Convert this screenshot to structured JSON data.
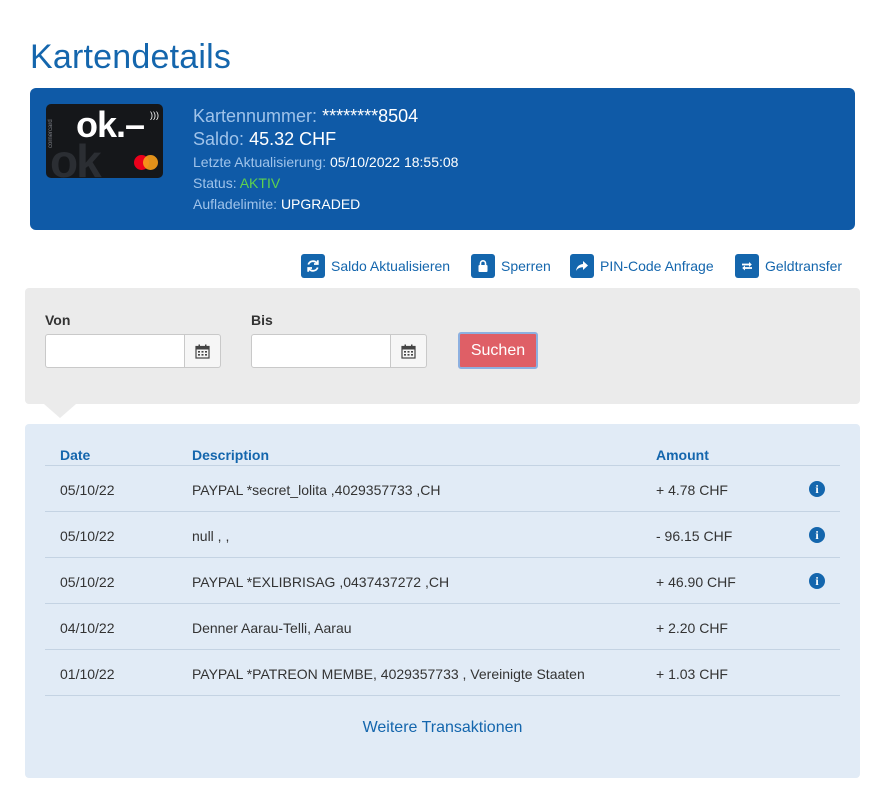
{
  "page": {
    "title": "Kartendetails"
  },
  "card": {
    "image": {
      "logo_text": "ok.–",
      "side_text": "cornercard",
      "brand": "mastercard-logo",
      "bg_color": "#15171a"
    },
    "number_label": "Kartennummer:",
    "number_value": "********8504",
    "balance_label": "Saldo:",
    "balance_value": "45.32 CHF",
    "updated_label": "Letzte Aktualisierung:",
    "updated_value": "05/10/2022 18:55:08",
    "status_label": "Status:",
    "status_value": "AKTIV",
    "limit_label": "Aufladelimite:",
    "limit_value": "UPGRADED",
    "panel_color": "#0f5aa7",
    "status_color": "#5ed24e"
  },
  "actions": [
    {
      "label": "Saldo Aktualisieren",
      "icon": "refresh-icon"
    },
    {
      "label": "Sperren",
      "icon": "lock-icon"
    },
    {
      "label": "PIN-Code Anfrage",
      "icon": "share-arrow-icon"
    },
    {
      "label": "Geldtransfer",
      "icon": "transfer-icon"
    }
  ],
  "filter": {
    "from_label": "Von",
    "from_value": "",
    "to_label": "Bis",
    "to_value": "",
    "search_label": "Suchen",
    "search_color": "#df5f66"
  },
  "transactions": {
    "columns": [
      "Date",
      "Description",
      "Amount"
    ],
    "rows": [
      {
        "date": "05/10/22",
        "description": "PAYPAL *secret_lolita ,4029357733 ,CH",
        "amount": "+ 4.78 CHF",
        "has_info": true
      },
      {
        "date": "05/10/22",
        "description": "null , ,",
        "amount": "- 96.15 CHF",
        "has_info": true
      },
      {
        "date": "05/10/22",
        "description": "PAYPAL *EXLIBRISAG ,0437437272 ,CH",
        "amount": "+ 46.90 CHF",
        "has_info": true
      },
      {
        "date": "04/10/22",
        "description": "Denner Aarau-Telli, Aarau",
        "amount": "+ 2.20 CHF",
        "has_info": false
      },
      {
        "date": "01/10/22",
        "description": "PAYPAL *PATREON MEMBE, 4029357733 , Vereinigte Staaten",
        "amount": "+ 1.03 CHF",
        "has_info": false
      }
    ],
    "info_icon_glyph": "i",
    "more_label": "Weitere Transaktionen"
  }
}
